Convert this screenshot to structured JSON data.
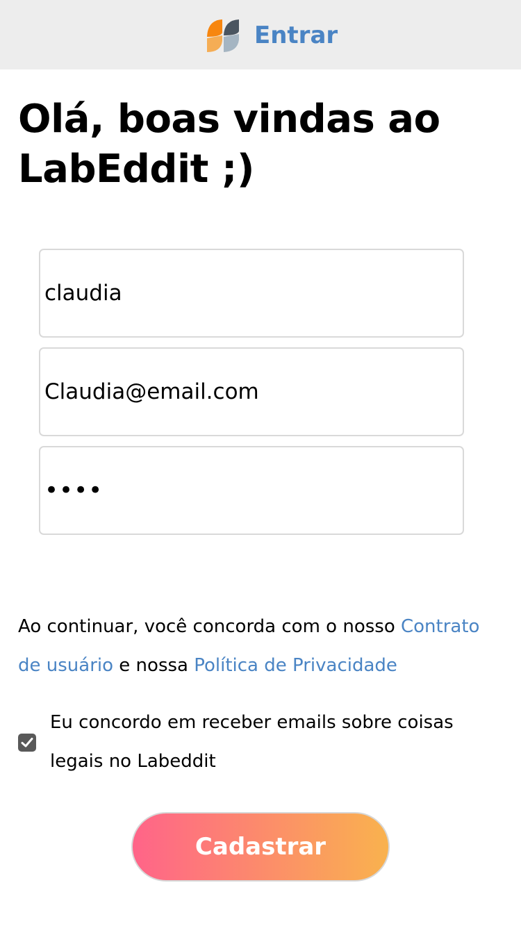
{
  "header": {
    "logo_icon": "labeddit-logo-icon",
    "login_label": "Entrar"
  },
  "title": "Olá, boas vindas ao LabEddit ;)",
  "form": {
    "username_value": "claudia",
    "email_value": "Claudia@email.com",
    "password_value": "1234"
  },
  "terms": {
    "prefix": "Ao continuar, você concorda com o nosso ",
    "user_agreement_link": "Contrato de usuário",
    "middle": " e nossa ",
    "privacy_policy_link": "Política de Privacidade"
  },
  "newsletter": {
    "checked": true,
    "label": "Eu concordo em receber emails sobre coisas legais no Labeddit"
  },
  "submit_label": "Cadastrar",
  "colors": {
    "accent_blue": "#4a84c4",
    "gradient_start": "#ff6489",
    "gradient_end": "#f9b24e",
    "header_bg": "#ededed"
  }
}
